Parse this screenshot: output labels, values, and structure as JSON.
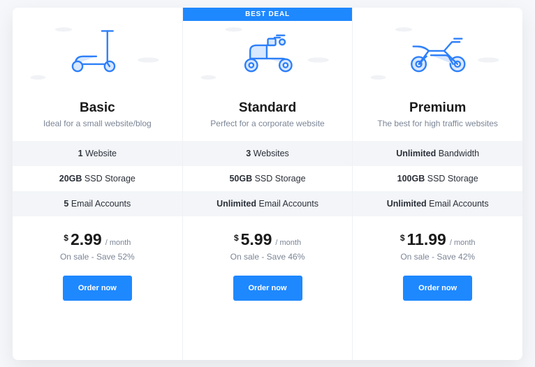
{
  "plans": [
    {
      "badge": null,
      "icon": "scooter-icon",
      "title": "Basic",
      "subtitle": "Ideal for a small website/blog",
      "features": [
        {
          "bold": "1",
          "rest": " Website"
        },
        {
          "bold": "20GB",
          "rest": " SSD Storage"
        },
        {
          "bold": "5",
          "rest": " Email Accounts"
        }
      ],
      "currency": "$",
      "amount": "2.99",
      "period": "/ month",
      "sale": "On sale - Save 52%",
      "cta": "Order now"
    },
    {
      "badge": "BEST DEAL",
      "icon": "moped-icon",
      "title": "Standard",
      "subtitle": "Perfect for a corporate website",
      "features": [
        {
          "bold": "3",
          "rest": " Websites"
        },
        {
          "bold": "50GB",
          "rest": " SSD Storage"
        },
        {
          "bold": "Unlimited",
          "rest": " Email Accounts"
        }
      ],
      "currency": "$",
      "amount": "5.99",
      "period": "/ month",
      "sale": "On sale - Save 46%",
      "cta": "Order now"
    },
    {
      "badge": null,
      "icon": "motorcycle-icon",
      "title": "Premium",
      "subtitle": "The best for high traffic websites",
      "features": [
        {
          "bold": "Unlimited",
          "rest": " Bandwidth"
        },
        {
          "bold": "100GB",
          "rest": " SSD Storage"
        },
        {
          "bold": "Unlimited",
          "rest": " Email Accounts"
        }
      ],
      "currency": "$",
      "amount": "11.99",
      "period": "/ month",
      "sale": "On sale - Save 42%",
      "cta": "Order now"
    }
  ]
}
